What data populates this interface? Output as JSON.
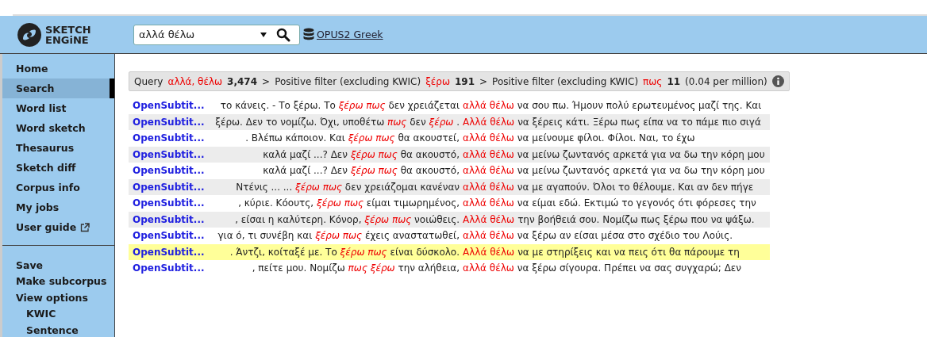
{
  "header": {
    "logo": {
      "line_1": "SKETCH",
      "line_2": "ENGiNE"
    },
    "search": {
      "value": "αλλά θέλω"
    },
    "corpus_link": "OPUS2 Greek"
  },
  "sidebar": {
    "groups": [
      {
        "items": [
          {
            "label": "Home",
            "selected": false
          },
          {
            "label": "Search",
            "selected": true
          },
          {
            "label": "Word list",
            "selected": false
          },
          {
            "label": "Word sketch",
            "selected": false
          },
          {
            "label": "Thesaurus",
            "selected": false
          },
          {
            "label": "Sketch diff",
            "selected": false
          },
          {
            "label": "Corpus info",
            "selected": false
          },
          {
            "label": "My jobs",
            "selected": false
          },
          {
            "label": "User guide",
            "selected": false,
            "external": true
          }
        ]
      },
      {
        "items": [
          {
            "label": "Save",
            "selected": false
          },
          {
            "label": "Make subcorpus",
            "selected": false
          },
          {
            "label": "View options",
            "selected": false,
            "children": [
              {
                "label": "KWIC",
                "selected": false
              },
              {
                "label": "Sentence",
                "selected": false
              }
            ]
          }
        ]
      }
    ]
  },
  "breadcrumb": {
    "separator": ">",
    "steps": [
      {
        "label": "Query",
        "term": "αλλά, θέλω",
        "count": "3,474"
      },
      {
        "label": "Positive filter (excluding KWIC)",
        "term": "ξέρω",
        "count": "191"
      },
      {
        "label": "Positive filter (excluding KWIC)",
        "term": "πως",
        "count": "11",
        "note": "(0.04 per million)"
      }
    ]
  },
  "concordance": [
    {
      "ref": "OpenSubtit...",
      "left": "το κάνεις. - Το ξέρω. Το *ξέρω πως* δεν χρειάζεται",
      "kwic": "αλλά θέλω",
      "right": "να σου πω. Ήμουν πολύ ερωτευμένος μαζί της. Και",
      "highlighted": false
    },
    {
      "ref": "OpenSubtit...",
      "left": "ξέρω. Δεν το νομίζω. Όχι, υποθέτω *πως* δεν *ξέρω* .",
      "kwic": "Αλλά θέλω",
      "right": "να ξέρεις κάτι. Ξέρω πως είπα να το πάμε πιο σιγά",
      "highlighted": false
    },
    {
      "ref": "OpenSubtit...",
      "left": ". Βλέπω κάποιον. Και *ξέρω πως* θα ακουστεί,",
      "kwic": "αλλά θέλω",
      "right": "να μείνουμε φίλοι. Φίλοι. Ναι, το έχω",
      "highlighted": false
    },
    {
      "ref": "OpenSubtit...",
      "left": "καλά μαζί ...? Δεν *ξέρω πως* θα ακουστό,",
      "kwic": "αλλά θέλω",
      "right": "να μείνω ζωντανός αρκετά για να δω την κόρη μου",
      "highlighted": false
    },
    {
      "ref": "OpenSubtit...",
      "left": "καλά μαζί ...? Δεν *ξέρω πως* θα ακουστό,",
      "kwic": "αλλά θέλω",
      "right": "να μείνω ζωντανός αρκετά για να δω την κόρη μου",
      "highlighted": false
    },
    {
      "ref": "OpenSubtit...",
      "left": "Ντένις ... ... *ξέρω πως* δεν χρειάζομαι κανέναν",
      "kwic": "αλλά θέλω",
      "right": "να με αγαπούν. Όλοι το θέλουμε. Και αν δεν πήγε",
      "highlighted": false
    },
    {
      "ref": "OpenSubtit...",
      "left": ", κύριε. Κόουτς, *ξέρω πως* είμαι τιμωρημένος,",
      "kwic": "αλλά θέλω",
      "right": "να είμαι εδώ. Εκτιμώ το γεγονός ότι φόρεσες την",
      "highlighted": false
    },
    {
      "ref": "OpenSubtit...",
      "left": ", είσαι η καλύτερη. Κόνορ, *ξέρω πως* νοιώθεις.",
      "kwic": "Αλλά θέλω",
      "right": "την βοήθειά σου. Νομίζω πως ξέρω που να ψάξω.",
      "highlighted": false
    },
    {
      "ref": "OpenSubtit...",
      "left": "για ό, τι συνέβη και *ξέρω πως* έχεις αναστατωθεί,",
      "kwic": "αλλά θέλω",
      "right": "να ξέρω αν είσαι μέσα στο σχέδιο του Λούις.",
      "highlighted": false
    },
    {
      "ref": "OpenSubtit...",
      "left": ". Άντζι, κοίταξέ με. Το *ξέρω πως* είναι δύσκολο.",
      "kwic": "Αλλά θέλω",
      "right": "να με στηρίξεις και να πεις ότι θα πάρουμε τη",
      "highlighted": true
    },
    {
      "ref": "OpenSubtit...",
      "left": ", πείτε μου. Νομίζω *πως ξέρω* την αλήθεια,",
      "kwic": "αλλά θέλω",
      "right": "να ξέρω σίγουρα. Πρέπει να σας συγχαρώ; Δεν",
      "highlighted": false
    }
  ]
}
